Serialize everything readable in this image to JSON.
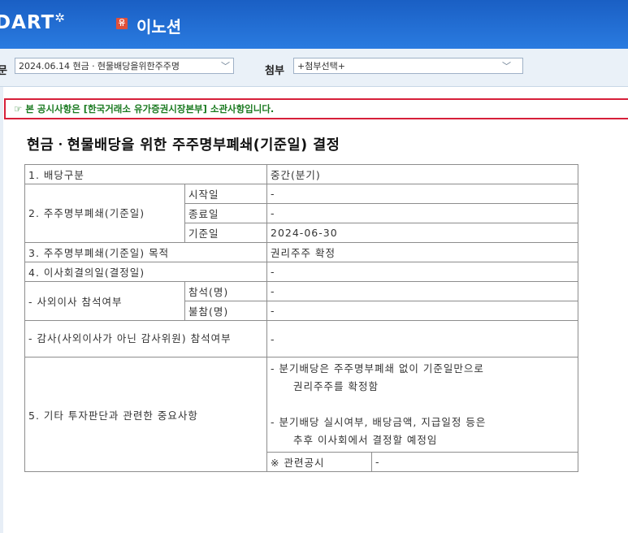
{
  "header": {
    "logo": "DART",
    "company_badge": "유",
    "company": "이노션"
  },
  "toolbar": {
    "report_label": "문",
    "report_value": "2024.06.14  현금ㆍ현물배당을위한주주명",
    "attach_label": "첨부",
    "attach_value": "+첨부선택+"
  },
  "notice": "☞ 본 공시사항은 [한국거래소 유가증권시장본부] 소관사항입니다.",
  "title": "현금ㆍ현물배당을 위한 주주명부폐쇄(기준일) 결정",
  "table": {
    "r1_label": "1. 배당구분",
    "r1_value": "중간(분기)",
    "r2_label": "2. 주주명부폐쇄(기준일)",
    "r2_start_label": "시작일",
    "r2_start_value": "-",
    "r2_end_label": "종료일",
    "r2_end_value": "-",
    "r2_base_label": "기준일",
    "r2_base_value": "2024-06-30",
    "r3_label": "3. 주주명부폐쇄(기준일) 목적",
    "r3_value": "권리주주 확정",
    "r4_label": "4. 이사회결의일(결정일)",
    "r4_value": "-",
    "r5_label": "- 사외이사 참석여부",
    "r5_present_label": "참석(명)",
    "r5_present_value": "-",
    "r5_absent_label": "불참(명)",
    "r5_absent_value": "-",
    "r6_label": "- 감사(사외이사가 아닌 감사위원) 참석여부",
    "r6_value": "-",
    "r7_label": "5. 기타 투자판단과 관련한 중요사항",
    "r7_note1": "- 분기배당은 주주명부폐쇄 없이 기준일만으로",
    "r7_note1b": "권리주주를 확정함",
    "r7_note2": "- 분기배당 실시여부, 배당금액, 지급일정 등은",
    "r7_note2b": "추후 이사회에서 결정할 예정임",
    "related_label": "※ 관련공시",
    "related_value": "-"
  }
}
